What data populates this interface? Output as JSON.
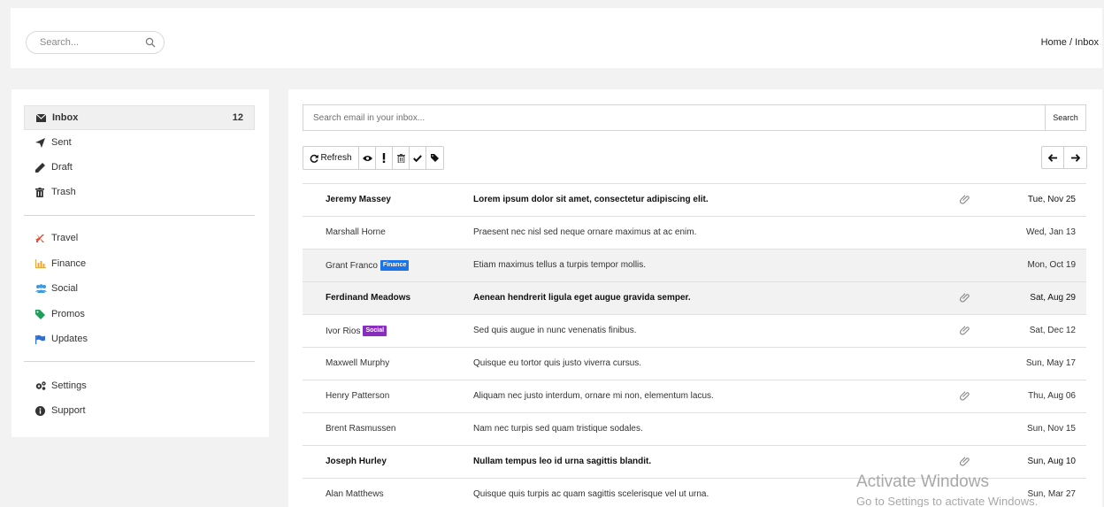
{
  "topbar": {
    "search_placeholder": "Search...",
    "breadcrumb": "Home / Inbox"
  },
  "sidebar": {
    "primary": [
      {
        "label": "Inbox",
        "icon": "envelope-icon",
        "count": "12",
        "active": true
      },
      {
        "label": "Sent",
        "icon": "paper-plane-icon"
      },
      {
        "label": "Draft",
        "icon": "pencil-icon"
      },
      {
        "label": "Trash",
        "icon": "trash-icon"
      }
    ],
    "labels": [
      {
        "label": "Travel",
        "icon": "plane-icon",
        "color": "#e8472f"
      },
      {
        "label": "Finance",
        "icon": "bar-chart-icon",
        "color": "#f0a530"
      },
      {
        "label": "Social",
        "icon": "users-icon",
        "color": "#3b9ae1"
      },
      {
        "label": "Promos",
        "icon": "tag-icon",
        "color": "#1e9e5b"
      },
      {
        "label": "Updates",
        "icon": "flag-icon",
        "color": "#2f6fd1"
      }
    ],
    "footer": [
      {
        "label": "Settings",
        "icon": "cogs-icon"
      },
      {
        "label": "Support",
        "icon": "info-icon"
      }
    ]
  },
  "inbox_search": {
    "placeholder": "Search email in your inbox...",
    "button": "Search"
  },
  "toolbar": {
    "refresh_label": "Refresh"
  },
  "emails": [
    {
      "sender": "Jeremy Massey",
      "subject": "Lorem ipsum dolor sit amet, consectetur adipiscing elit.",
      "date": "Tue, Nov 25",
      "unread": true,
      "attachment": true
    },
    {
      "sender": "Marshall Horne",
      "subject": "Praesent nec nisl sed neque ornare maximus at ac enim.",
      "date": "Wed, Jan 13",
      "unread": false,
      "attachment": false
    },
    {
      "sender": "Grant Franco",
      "tag": "Finance",
      "tag_color": "#1a73e8",
      "subject": "Etiam maximus tellus a turpis tempor mollis.",
      "date": "Mon, Oct 19",
      "unread": false,
      "attachment": false,
      "shaded": true
    },
    {
      "sender": "Ferdinand Meadows",
      "subject": "Aenean hendrerit ligula eget augue gravida semper.",
      "date": "Sat, Aug 29",
      "unread": true,
      "attachment": true,
      "shaded": true
    },
    {
      "sender": "Ivor Rios",
      "tag": "Social",
      "tag_color": "#8a2bc2",
      "subject": "Sed quis augue in nunc venenatis finibus.",
      "date": "Sat, Dec 12",
      "unread": false,
      "attachment": true
    },
    {
      "sender": "Maxwell Murphy",
      "subject": "Quisque eu tortor quis justo viverra cursus.",
      "date": "Sun, May 17",
      "unread": false,
      "attachment": false
    },
    {
      "sender": "Henry Patterson",
      "subject": "Aliquam nec justo interdum, ornare mi non, elementum lacus.",
      "date": "Thu, Aug 06",
      "unread": false,
      "attachment": true
    },
    {
      "sender": "Brent Rasmussen",
      "subject": "Nam nec turpis sed quam tristique sodales.",
      "date": "Sun, Nov 15",
      "unread": false,
      "attachment": false
    },
    {
      "sender": "Joseph Hurley",
      "subject": "Nullam tempus leo id urna sagittis blandit.",
      "date": "Sun, Aug 10",
      "unread": true,
      "attachment": true
    },
    {
      "sender": "Alan Matthews",
      "subject": "Quisque quis turpis ac quam sagittis scelerisque vel ut urna.",
      "date": "Sun, Mar 27",
      "unread": false,
      "attachment": false
    }
  ],
  "watermark": {
    "line1": "Activate Windows",
    "line2": "Go to Settings to activate Windows."
  }
}
